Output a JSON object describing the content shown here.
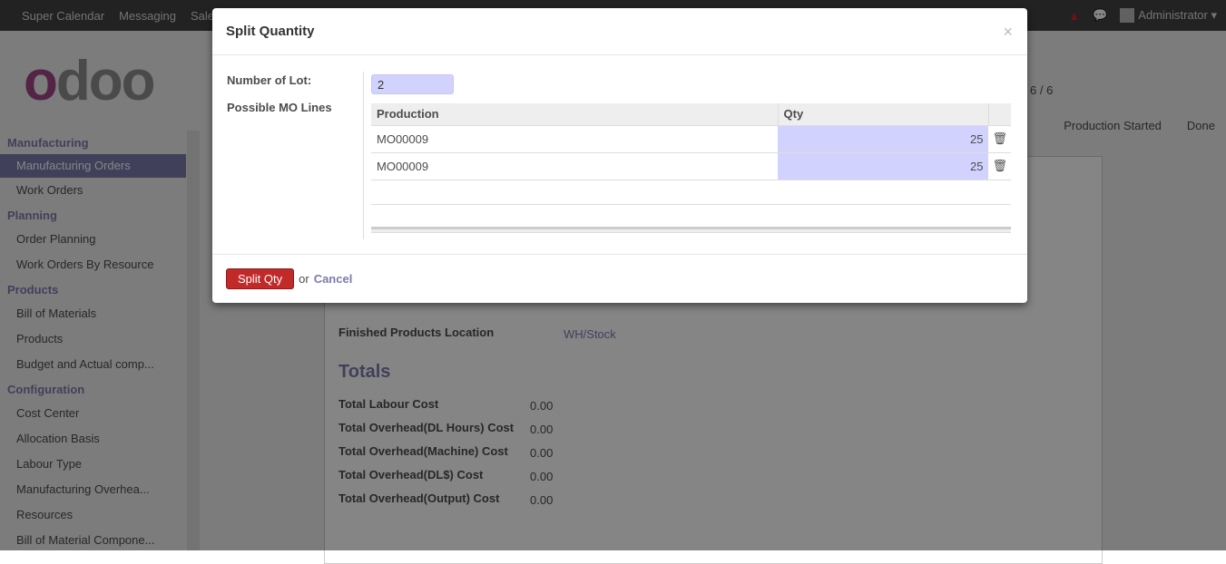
{
  "nav": {
    "menus": [
      "Super Calendar",
      "Messaging",
      "Sales"
    ],
    "user": "Administrator"
  },
  "sidebar": {
    "sections": [
      {
        "title": "Manufacturing",
        "items": [
          "Manufacturing Orders",
          "Work Orders"
        ]
      },
      {
        "title": "Planning",
        "items": [
          "Order Planning",
          "Work Orders By Resource"
        ]
      },
      {
        "title": "Products",
        "items": [
          "Bill of Materials",
          "Products",
          "Budget and Actual comp..."
        ]
      },
      {
        "title": "Configuration",
        "items": [
          "Cost Center",
          "Allocation Basis",
          "Labour Type",
          "Manufacturing Overhea...",
          "Resources",
          "Bill of Material Compone..."
        ]
      }
    ],
    "active": "Manufacturing Orders"
  },
  "main": {
    "pager": "6 / 6",
    "status": [
      "Production Started",
      "Done"
    ],
    "location_label": "Finished Products Location",
    "location_value": "WH/Stock",
    "totals_title": "Totals",
    "totals": [
      {
        "label": "Total Labour Cost",
        "value": "0.00"
      },
      {
        "label": "Total Overhead(DL Hours) Cost",
        "value": "0.00"
      },
      {
        "label": "Total Overhead(Machine) Cost",
        "value": "0.00"
      },
      {
        "label": "Total Overhead(DL$) Cost",
        "value": "0.00"
      },
      {
        "label": "Total Overhead(Output) Cost",
        "value": "0.00"
      }
    ]
  },
  "dialog": {
    "title": "Split Quantity",
    "close": "×",
    "lot_label": "Number of Lot:",
    "lot_value": "2",
    "lines_label": "Possible MO Lines",
    "columns": [
      "Production",
      "Qty"
    ],
    "rows": [
      {
        "production": "MO00009",
        "qty": "25"
      },
      {
        "production": "MO00009",
        "qty": "25"
      }
    ],
    "split_button": "Split Qty",
    "or": "or",
    "cancel": "Cancel"
  }
}
